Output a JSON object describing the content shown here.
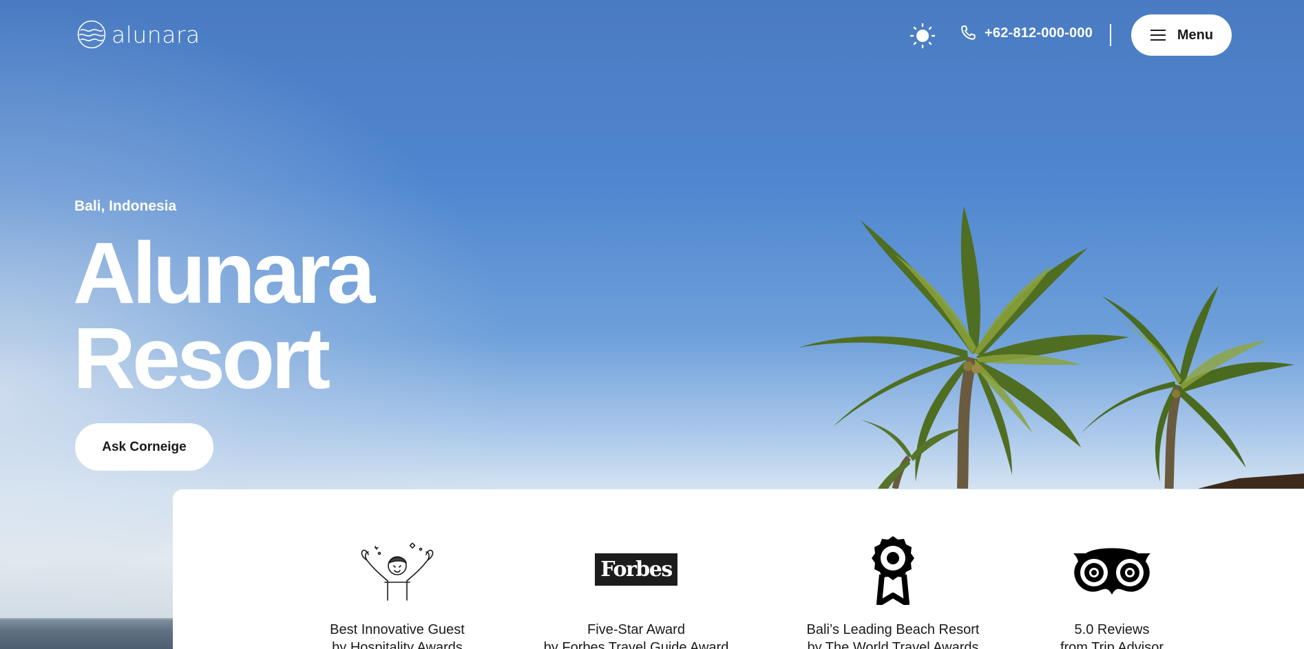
{
  "header": {
    "logo_text": "alunara",
    "phone": "+62-812-000-000",
    "menu_label": "Menu"
  },
  "hero": {
    "location": "Bali, Indonesia",
    "title_line1": "Alunara",
    "title_line2": "Resort",
    "cta_label": "Ask Corneige"
  },
  "awards": [
    {
      "icon": "celebrating-guest-icon",
      "title": "Best Innovative Guest",
      "subtitle": "by Hospitality Awards"
    },
    {
      "icon": "forbes-logo",
      "brand": "Forbes",
      "title": "Five-Star Award",
      "subtitle": "by Forbes Travel Guide Award"
    },
    {
      "icon": "ribbon-medal-icon",
      "title": "Bali’s Leading Beach Resort",
      "subtitle": "by The World Travel Awards"
    },
    {
      "icon": "tripadvisor-owl-icon",
      "title": "5.0 Reviews",
      "subtitle": "from Trip Advisor"
    }
  ],
  "colors": {
    "sky_top": "#4a7bc2",
    "sky_bottom": "#eef1f1",
    "button_bg": "#ffffff",
    "text_dark": "#1a1a1a"
  }
}
